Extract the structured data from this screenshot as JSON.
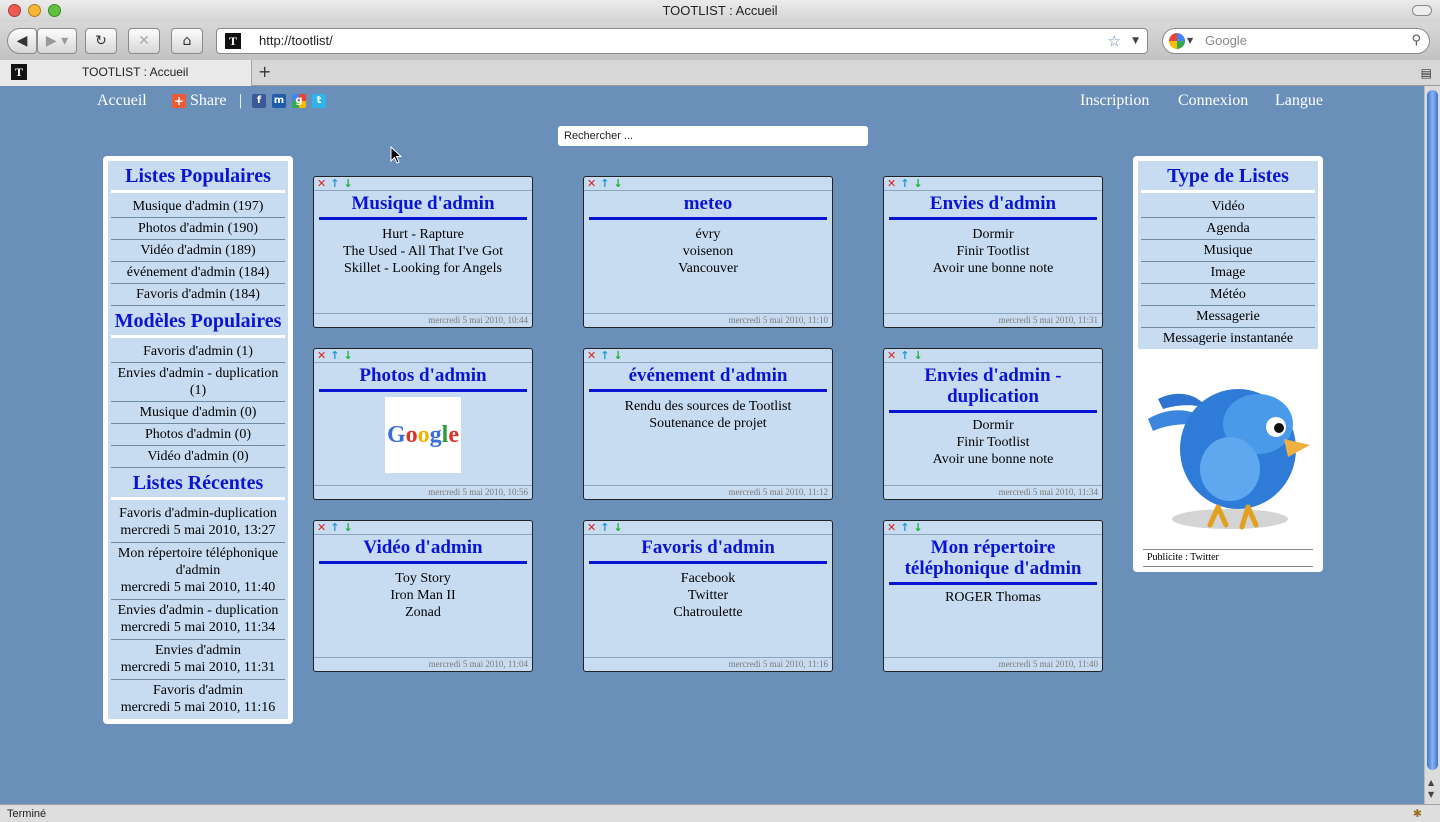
{
  "window": {
    "title": "TOOTLIST : Accueil"
  },
  "toolbar": {
    "url": "http://tootlist/",
    "search_placeholder": "Google",
    "site_icon": "T"
  },
  "tab": {
    "label": "TOOTLIST : Accueil",
    "new_tab": "+"
  },
  "status": {
    "text": "Terminé"
  },
  "icons": {
    "back": "back-arrow-icon",
    "forward": "forward-arrow-icon",
    "reload": "reload-icon",
    "stop": "stop-icon",
    "home": "home-icon",
    "bookmark": "star-icon",
    "search": "magnifier-icon",
    "share": "share-plus-icon",
    "facebook": "facebook-icon",
    "myspace": "myspace-icon",
    "google": "google-icon",
    "twitter": "twitter-icon",
    "delete": "delete-x-icon",
    "up": "arrow-up-icon",
    "down": "arrow-down-icon"
  },
  "colors": {
    "page_bg": "#6a8fb9",
    "title_blue": "#0a15d4",
    "panel_bg": "#c8dcf1"
  },
  "nav": {
    "accueil": "Accueil",
    "share": "Share",
    "separator": "|",
    "inscription": "Inscription",
    "connexion": "Connexion",
    "langue": "Langue"
  },
  "search": {
    "placeholder": "Rechercher ..."
  },
  "left": {
    "popular_title": "Listes Populaires",
    "popular": [
      "Musique d'admin (197)",
      "Photos d'admin (190)",
      "Vidéo d'admin (189)",
      "événement d'admin (184)",
      "Favoris d'admin (184)"
    ],
    "models_title": "Modèles Populaires",
    "models": [
      "Favoris d'admin (1)",
      "Envies d'admin - duplication (1)",
      "Musique d'admin (0)",
      "Photos d'admin (0)",
      "Vidéo d'admin (0)"
    ],
    "recent_title": "Listes Récentes",
    "recent": [
      {
        "name": "Favoris d'admin-duplication",
        "date": "mercredi 5 mai 2010, 13:27"
      },
      {
        "name": "Mon répertoire téléphonique d'admin",
        "date": "mercredi 5 mai 2010, 11:40"
      },
      {
        "name": "Envies d'admin - duplication",
        "date": "mercredi 5 mai 2010, 11:34"
      },
      {
        "name": "Envies d'admin",
        "date": "mercredi 5 mai 2010, 11:31"
      },
      {
        "name": "Favoris d'admin",
        "date": "mercredi 5 mai 2010, 11:16"
      }
    ]
  },
  "right": {
    "types_title": "Type de Listes",
    "types": [
      "Vidéo",
      "Agenda",
      "Musique",
      "Image",
      "Météo",
      "Messagerie",
      "Messagerie instantanée"
    ],
    "ad_caption": "Publicite : Twitter"
  },
  "cards": [
    {
      "title": "Musique d'admin",
      "lines": [
        "Hurt - Rapture",
        "The Used - All That I've Got",
        "Skillet - Looking for Angels"
      ],
      "date": "mercredi 5 mai 2010, 10:44"
    },
    {
      "title": "meteo",
      "lines": [
        "évry",
        "voisenon",
        "Vancouver"
      ],
      "date": "mercredi 5 mai 2010, 11:10"
    },
    {
      "title": "Envies d'admin",
      "lines": [
        "Dormir",
        "Finir Tootlist",
        "Avoir une bonne note"
      ],
      "date": "mercredi 5 mai 2010, 11:31"
    },
    {
      "title": "Photos d'admin",
      "lines": [],
      "image": "Google",
      "date": "mercredi 5 mai 2010, 10:56"
    },
    {
      "title": "événement d'admin",
      "lines": [
        "Rendu des sources de Tootlist",
        "Soutenance de projet"
      ],
      "date": "mercredi 5 mai 2010, 11:12"
    },
    {
      "title": "Envies d'admin - duplication",
      "lines": [
        "Dormir",
        "Finir Tootlist",
        "Avoir une bonne note"
      ],
      "date": "mercredi 5 mai 2010, 11:34"
    },
    {
      "title": "Vidéo d'admin",
      "lines": [
        "Toy Story",
        "Iron Man II",
        "Zonad"
      ],
      "date": "mercredi 5 mai 2010, 11:04"
    },
    {
      "title": "Favoris d'admin",
      "lines": [
        "Facebook",
        "Twitter",
        "Chatroulette"
      ],
      "date": "mercredi 5 mai 2010, 11:16"
    },
    {
      "title": "Mon répertoire téléphonique d'admin",
      "lines": [
        "ROGER Thomas"
      ],
      "date": "mercredi 5 mai 2010, 11:40"
    }
  ]
}
